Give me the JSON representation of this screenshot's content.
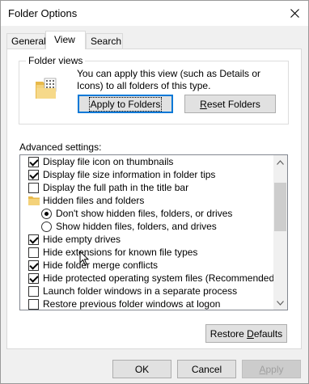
{
  "window": {
    "title": "Folder Options"
  },
  "tabs": [
    {
      "label": "General"
    },
    {
      "label": "View"
    },
    {
      "label": "Search"
    }
  ],
  "folder_views": {
    "legend": "Folder views",
    "description": "You can apply this view (such as Details or Icons) to all folders of this type.",
    "apply_button": {
      "label_prefix": "Apply to Fo",
      "label_underlined": "",
      "label_suffix": "lders"
    },
    "reset_button": {
      "label_underlined": "R",
      "label_suffix": "eset Folders"
    }
  },
  "advanced": {
    "label": "Advanced settings:",
    "items": [
      {
        "type": "checkbox",
        "checked": true,
        "indent": 1,
        "label": "Display file icon on thumbnails"
      },
      {
        "type": "checkbox",
        "checked": true,
        "indent": 1,
        "label": "Display file size information in folder tips"
      },
      {
        "type": "checkbox",
        "checked": false,
        "indent": 1,
        "label": "Display the full path in the title bar"
      },
      {
        "type": "folder",
        "indent": 1,
        "label": "Hidden files and folders"
      },
      {
        "type": "radio",
        "checked": true,
        "indent": 2,
        "label": "Don't show hidden files, folders, or drives"
      },
      {
        "type": "radio",
        "checked": false,
        "indent": 2,
        "label": "Show hidden files, folders, and drives"
      },
      {
        "type": "checkbox",
        "checked": true,
        "indent": 1,
        "label": "Hide empty drives"
      },
      {
        "type": "checkbox",
        "checked": false,
        "indent": 1,
        "label": "Hide extensions for known file types"
      },
      {
        "type": "checkbox",
        "checked": true,
        "indent": 1,
        "label": "Hide folder merge conflicts"
      },
      {
        "type": "checkbox",
        "checked": true,
        "indent": 1,
        "label": "Hide protected operating system files (Recommended)"
      },
      {
        "type": "checkbox",
        "checked": false,
        "indent": 1,
        "label": "Launch folder windows in a separate process"
      },
      {
        "type": "checkbox",
        "checked": false,
        "indent": 1,
        "label": "Restore previous folder windows at logon"
      }
    ]
  },
  "restore_defaults": {
    "label_prefix": "Restore ",
    "label_underlined": "D",
    "label_suffix": "efaults"
  },
  "footer": {
    "ok": "OK",
    "cancel": "Cancel",
    "apply_underlined": "A",
    "apply_suffix": "pply"
  },
  "colors": {
    "focus_border": "#0078d7",
    "disabled_text": "#a0a0a0",
    "folder_yellow": "#f4d27a"
  },
  "icons": {
    "close": "close-icon",
    "folder": "folder-icon",
    "scroll_up": "chevron-up-icon",
    "scroll_down": "chevron-down-icon",
    "cursor": "mouse-pointer-icon"
  }
}
